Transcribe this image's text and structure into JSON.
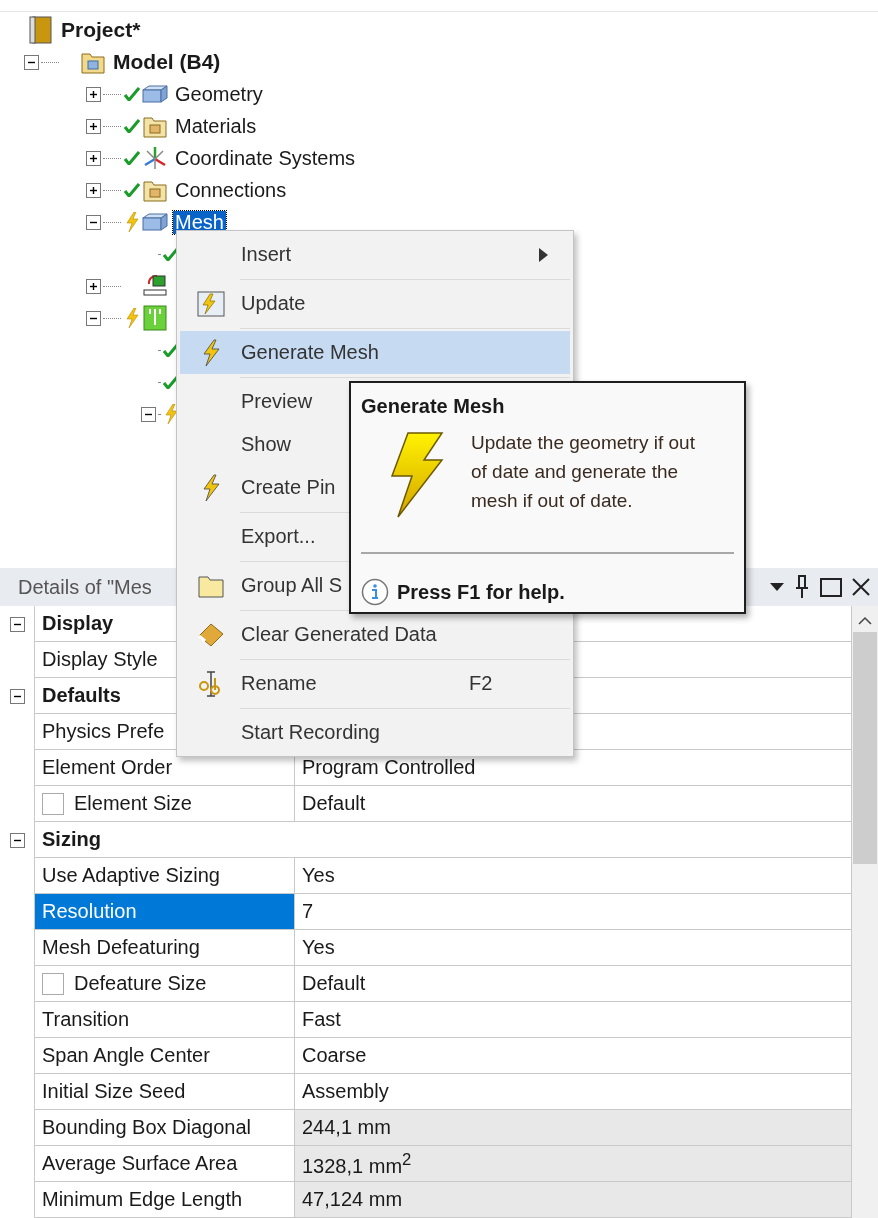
{
  "tree": {
    "items": [
      {
        "label": "Project*",
        "kind": "project",
        "selected": false,
        "children": [
          {
            "label": "Model (B4)",
            "kind": "model",
            "expanded": true,
            "selected": false,
            "children": [
              {
                "label": "Geometry",
                "kind": "geometry",
                "expanded": false,
                "up_to_date": true,
                "selected": false
              },
              {
                "label": "Materials",
                "kind": "folder",
                "expanded": false,
                "up_to_date": true,
                "selected": false
              },
              {
                "label": "Coordinate Systems",
                "kind": "axes",
                "expanded": false,
                "up_to_date": true,
                "selected": false
              },
              {
                "label": "Connections",
                "kind": "folder",
                "expanded": false,
                "up_to_date": true,
                "selected": false
              },
              {
                "label": "Mesh",
                "kind": "geometry",
                "expanded": true,
                "up_to_date": false,
                "selected": true,
                "children": [
                  {
                    "up_to_date": true
                  }
                ]
              },
              {
                "kind": "support",
                "expanded": false
              },
              {
                "kind": "solution",
                "expanded": true,
                "up_to_date": false,
                "children": [
                  {
                    "up_to_date": true
                  },
                  {
                    "up_to_date": true
                  },
                  {
                    "expanded": true,
                    "up_to_date": false
                  }
                ]
              }
            ]
          }
        ]
      }
    ]
  },
  "context_menu": {
    "items": [
      {
        "label": "Insert",
        "kind": "plain",
        "submenu": true,
        "selected": false,
        "divider": true
      },
      {
        "label": "Update",
        "kind": "update",
        "selected": false,
        "divider": true
      },
      {
        "label": "Generate Mesh",
        "kind": "bolt",
        "selected": true,
        "divider": true
      },
      {
        "label": "Preview",
        "kind": "plain",
        "selected": false
      },
      {
        "label": "Show",
        "kind": "plain",
        "selected": false
      },
      {
        "label": "Create Pin",
        "kind": "bolt",
        "selected": false,
        "divider": true
      },
      {
        "label": "Export...",
        "kind": "plain",
        "selected": false,
        "divider": true
      },
      {
        "label": "Group All S",
        "kind": "folder",
        "selected": false,
        "divider": true
      },
      {
        "label": "Clear Generated Data",
        "kind": "eraser",
        "selected": false,
        "divider": true
      },
      {
        "label": "Rename",
        "kind": "rename",
        "shortcut": "F2",
        "selected": false,
        "divider": true
      },
      {
        "label": "Start Recording",
        "kind": "plain",
        "selected": false
      }
    ]
  },
  "tooltip": {
    "title": "Generate Mesh",
    "body": "Update the geometry if out of date and generate the mesh if out of date.",
    "footer": "Press F1 for help."
  },
  "details": {
    "title": "Details of \"Mes",
    "rows": [
      {
        "kind": "section",
        "label": "Display",
        "expanded": true
      },
      {
        "kind": "property",
        "label": "Display Style",
        "selected": false,
        "readonly": false
      },
      {
        "kind": "section",
        "label": "Defaults",
        "expanded": true
      },
      {
        "kind": "property",
        "label": "Physics Prefe",
        "selected": false,
        "readonly": false
      },
      {
        "kind": "property",
        "label": "Element Order",
        "value": "Program Controlled",
        "selected": false,
        "readonly": false
      },
      {
        "kind": "property",
        "label": "Element Size",
        "value": "Default",
        "checked": false,
        "selected": false,
        "readonly": false
      },
      {
        "kind": "section",
        "label": "Sizing",
        "expanded": true
      },
      {
        "kind": "property",
        "label": "Use Adaptive Sizing",
        "value": "Yes",
        "selected": false,
        "readonly": false
      },
      {
        "kind": "property",
        "label": "Resolution",
        "value": "7",
        "selected": true,
        "readonly": false
      },
      {
        "kind": "property",
        "label": "Mesh Defeaturing",
        "value": "Yes",
        "selected": false,
        "readonly": false
      },
      {
        "kind": "property",
        "label": "Defeature Size",
        "value": "Default",
        "checked": false,
        "selected": false,
        "readonly": false
      },
      {
        "kind": "property",
        "label": "Transition",
        "value": "Fast",
        "selected": false,
        "readonly": false
      },
      {
        "kind": "property",
        "label": "Span Angle Center",
        "value": "Coarse",
        "selected": false,
        "readonly": false
      },
      {
        "kind": "property",
        "label": "Initial Size Seed",
        "value": "Assembly",
        "selected": false,
        "readonly": false
      },
      {
        "kind": "property",
        "label": "Bounding Box Diagonal",
        "value": "244,1 mm",
        "selected": false,
        "readonly": true
      },
      {
        "kind": "property",
        "label": "Average Surface Area",
        "value": "1328,1 mm$^{2}$",
        "selected": false,
        "readonly": true
      },
      {
        "kind": "property",
        "label": "Minimum Edge Length",
        "value": "47,124 mm",
        "selected": false,
        "readonly": true
      }
    ]
  }
}
